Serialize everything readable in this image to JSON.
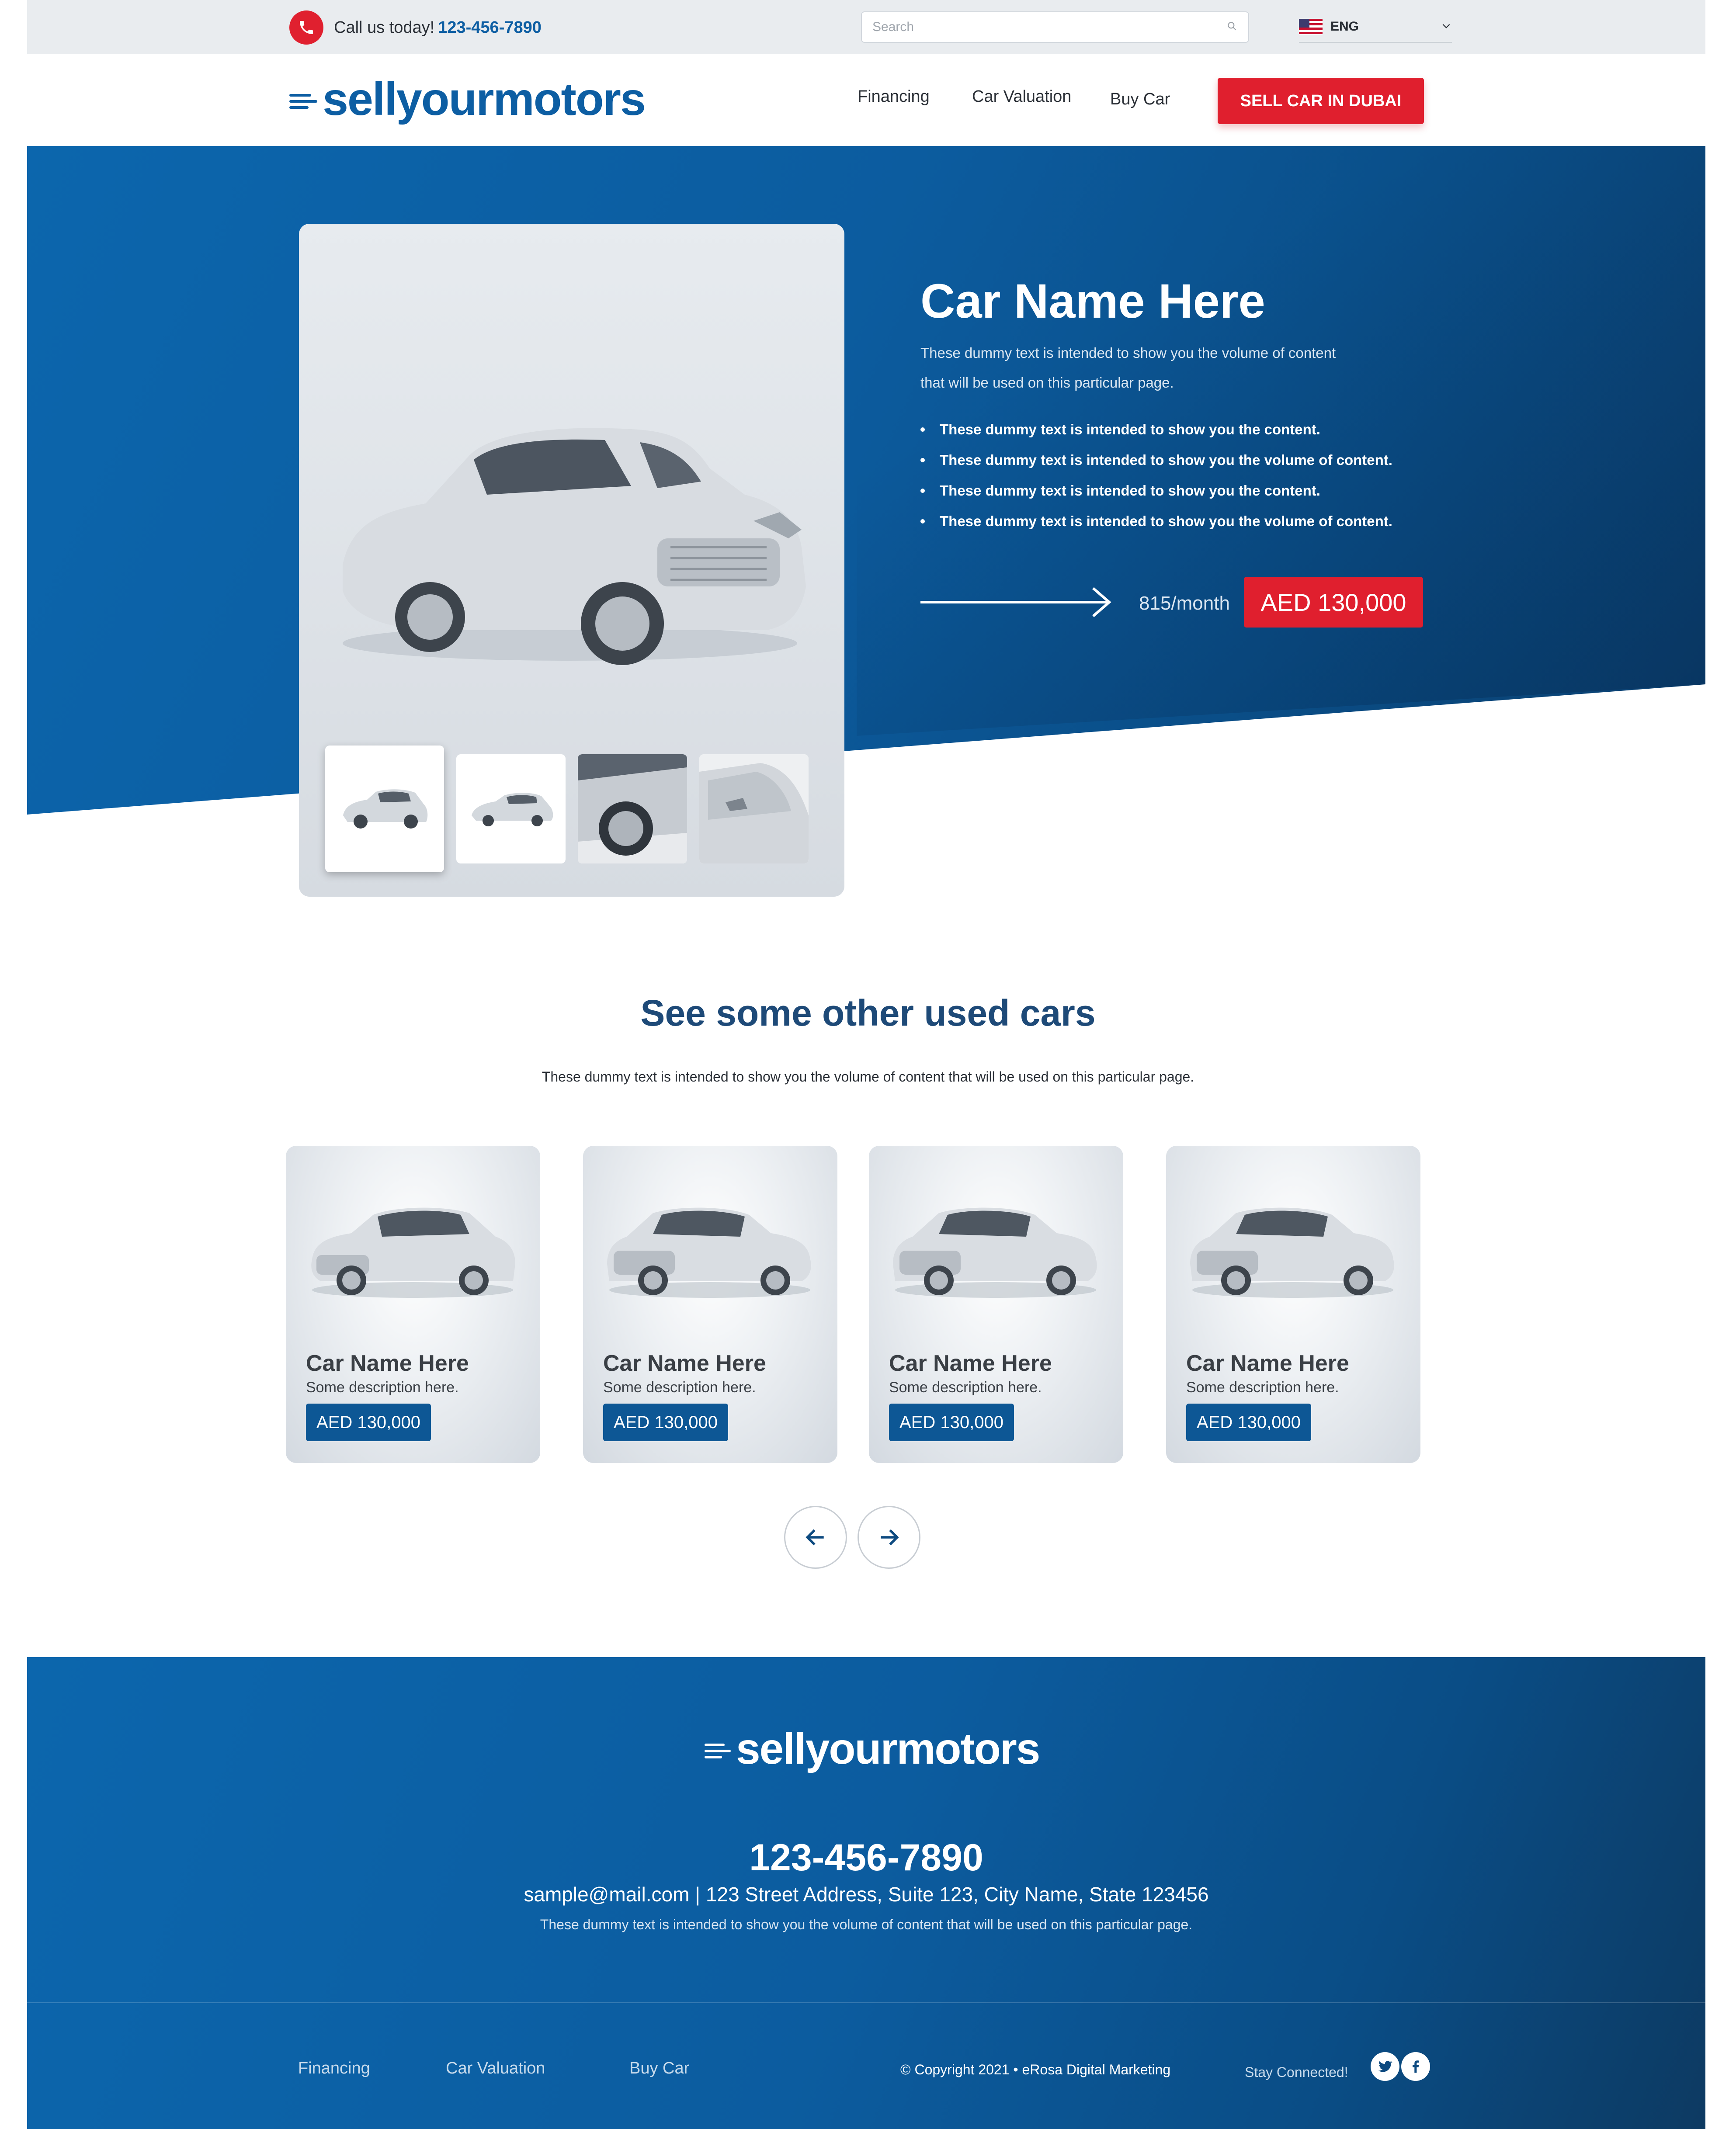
{
  "topbar": {
    "call_label": "Call us today!",
    "phone": "123-456-7890",
    "search_placeholder": "Search",
    "language": "ENG"
  },
  "header": {
    "logo_part1": "sellyour",
    "logo_part2": "motors",
    "nav": [
      "Financing",
      "Car Valuation",
      "Buy Car"
    ],
    "cta": "SELL CAR IN DUBAI"
  },
  "hero": {
    "title": "Car Name Here",
    "description": "These dummy text is intended to show you the volume of content that will be used on this particular page.",
    "bullets": [
      "These dummy text is intended to show you the content.",
      "These dummy text is intended to show you the volume of content.",
      "These dummy text is intended to show you the content.",
      "These dummy text is intended to show you the volume of content."
    ],
    "monthly": "815/month",
    "price": "AED 130,000"
  },
  "others": {
    "title": "See some other used cars",
    "description": "These dummy text is intended to show you the volume of content that will be used on this particular page.",
    "cards": [
      {
        "title": "Car Name Here",
        "desc": "Some description here.",
        "price": "AED 130,000"
      },
      {
        "title": "Car Name Here",
        "desc": "Some description here.",
        "price": "AED 130,000"
      },
      {
        "title": "Car Name Here",
        "desc": "Some description here.",
        "price": "AED 130,000"
      },
      {
        "title": "Car Name Here",
        "desc": "Some description here.",
        "price": "AED 130,000"
      }
    ]
  },
  "footer": {
    "logo": "sellyourmotors",
    "phone": "123-456-7890",
    "address": "sample@mail.com | 123 Street Address, Suite 123, City Name, State 123456",
    "description": "These dummy text is intended to show you the volume of content that will be used on this particular page.",
    "links": [
      "Financing",
      "Car Valuation",
      "Buy Car"
    ],
    "copyright": "© Copyright 2021  •  eRosa Digital Marketing",
    "stay_connected": "Stay Connected!"
  },
  "icons": {
    "phone": "phone-icon",
    "search": "search-icon",
    "flag": "us-flag-icon",
    "chevron": "chevron-down-icon",
    "arrow_left": "arrow-left-icon",
    "arrow_right": "arrow-right-icon",
    "twitter": "twitter-icon",
    "facebook": "facebook-icon"
  },
  "colors": {
    "brand_blue": "#0d5ea3",
    "accent_red": "#e01f2e",
    "dark_blue": "#0b3f6e"
  }
}
